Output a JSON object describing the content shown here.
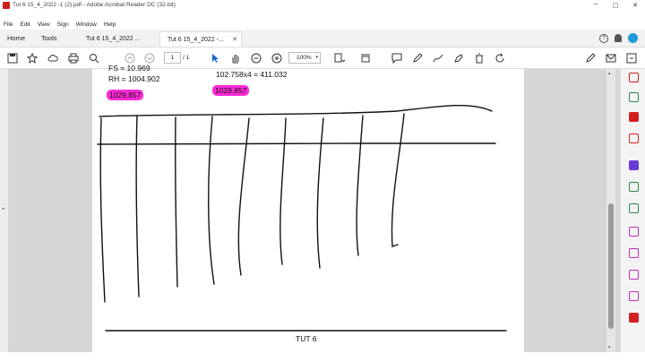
{
  "window": {
    "title": "Tut 6 15_4_2022 -1 (2).pdf - Adobe Acrobat Reader DC (32-bit)",
    "minimize": "─",
    "maximize": "▢",
    "close": "✕"
  },
  "menu": [
    "File",
    "Edit",
    "View",
    "Sign",
    "Window",
    "Help"
  ],
  "tabs": {
    "home": "Home",
    "tools": "Tools",
    "doc1": "Tut 6 15_4_2022 ...",
    "doc2": "Tut 6 15_4_2022 -...",
    "close_glyph": "✕",
    "help_glyph": "?"
  },
  "toolbar": {
    "page_current": "1",
    "page_total": "/ 1",
    "zoom": "100%",
    "zoom_dropdown": "▾"
  },
  "document": {
    "line_fs": "FS = 10.969",
    "line_rh": "RH = 1004.902",
    "line_calc": "102.758x4 = 411.032",
    "highlight_left": "1029.857",
    "highlight_right": "1029.857",
    "footer": "TUT 6"
  },
  "colors": {
    "highlight": "#ff2bd6",
    "acrobat_red": "#d21f1f",
    "avatar": "#1e9ad6"
  }
}
